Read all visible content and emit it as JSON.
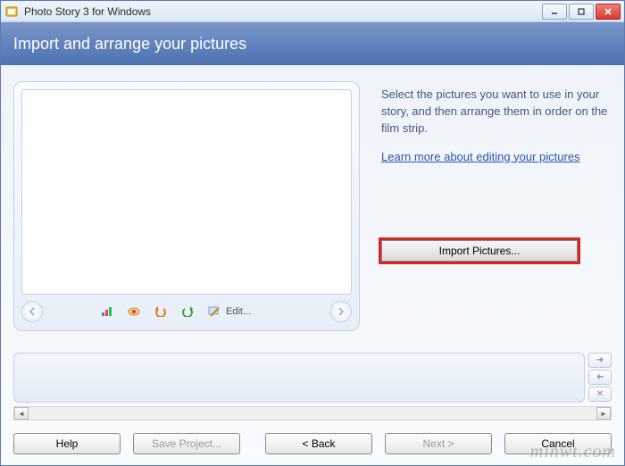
{
  "window": {
    "title": "Photo Story 3 for Windows"
  },
  "header": {
    "heading": "Import and arrange your pictures"
  },
  "instructions": {
    "text": "Select the pictures you want to use in your story, and then arrange them in order on the film strip.",
    "learn_more": "Learn more about editing your pictures"
  },
  "toolbar": {
    "edit_label": "Edit..."
  },
  "buttons": {
    "import": "Import Pictures...",
    "help": "Help",
    "save_project": "Save Project...",
    "back": "< Back",
    "next": "Next >",
    "cancel": "Cancel"
  },
  "watermark": "minwt.com"
}
